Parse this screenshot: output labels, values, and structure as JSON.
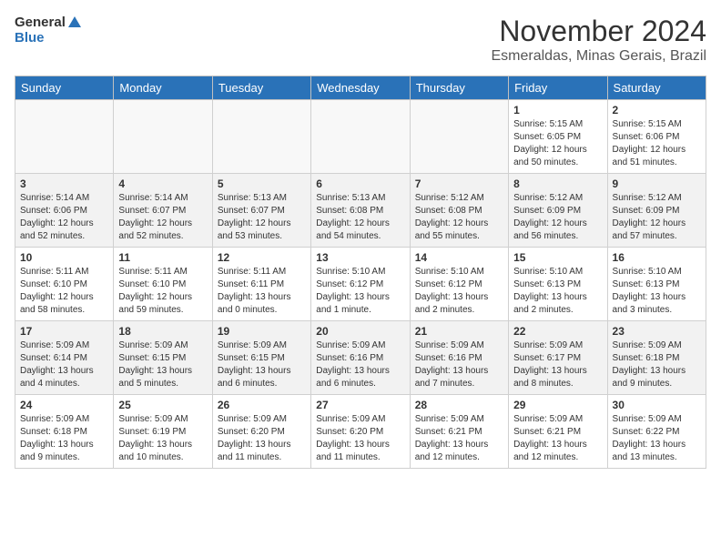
{
  "header": {
    "logo_line1": "General",
    "logo_line2": "Blue",
    "month": "November 2024",
    "location": "Esmeraldas, Minas Gerais, Brazil"
  },
  "days_of_week": [
    "Sunday",
    "Monday",
    "Tuesday",
    "Wednesday",
    "Thursday",
    "Friday",
    "Saturday"
  ],
  "weeks": [
    [
      {
        "day": "",
        "info": ""
      },
      {
        "day": "",
        "info": ""
      },
      {
        "day": "",
        "info": ""
      },
      {
        "day": "",
        "info": ""
      },
      {
        "day": "",
        "info": ""
      },
      {
        "day": "1",
        "info": "Sunrise: 5:15 AM\nSunset: 6:05 PM\nDaylight: 12 hours and 50 minutes."
      },
      {
        "day": "2",
        "info": "Sunrise: 5:15 AM\nSunset: 6:06 PM\nDaylight: 12 hours and 51 minutes."
      }
    ],
    [
      {
        "day": "3",
        "info": "Sunrise: 5:14 AM\nSunset: 6:06 PM\nDaylight: 12 hours and 52 minutes."
      },
      {
        "day": "4",
        "info": "Sunrise: 5:14 AM\nSunset: 6:07 PM\nDaylight: 12 hours and 52 minutes."
      },
      {
        "day": "5",
        "info": "Sunrise: 5:13 AM\nSunset: 6:07 PM\nDaylight: 12 hours and 53 minutes."
      },
      {
        "day": "6",
        "info": "Sunrise: 5:13 AM\nSunset: 6:08 PM\nDaylight: 12 hours and 54 minutes."
      },
      {
        "day": "7",
        "info": "Sunrise: 5:12 AM\nSunset: 6:08 PM\nDaylight: 12 hours and 55 minutes."
      },
      {
        "day": "8",
        "info": "Sunrise: 5:12 AM\nSunset: 6:09 PM\nDaylight: 12 hours and 56 minutes."
      },
      {
        "day": "9",
        "info": "Sunrise: 5:12 AM\nSunset: 6:09 PM\nDaylight: 12 hours and 57 minutes."
      }
    ],
    [
      {
        "day": "10",
        "info": "Sunrise: 5:11 AM\nSunset: 6:10 PM\nDaylight: 12 hours and 58 minutes."
      },
      {
        "day": "11",
        "info": "Sunrise: 5:11 AM\nSunset: 6:10 PM\nDaylight: 12 hours and 59 minutes."
      },
      {
        "day": "12",
        "info": "Sunrise: 5:11 AM\nSunset: 6:11 PM\nDaylight: 13 hours and 0 minutes."
      },
      {
        "day": "13",
        "info": "Sunrise: 5:10 AM\nSunset: 6:12 PM\nDaylight: 13 hours and 1 minute."
      },
      {
        "day": "14",
        "info": "Sunrise: 5:10 AM\nSunset: 6:12 PM\nDaylight: 13 hours and 2 minutes."
      },
      {
        "day": "15",
        "info": "Sunrise: 5:10 AM\nSunset: 6:13 PM\nDaylight: 13 hours and 2 minutes."
      },
      {
        "day": "16",
        "info": "Sunrise: 5:10 AM\nSunset: 6:13 PM\nDaylight: 13 hours and 3 minutes."
      }
    ],
    [
      {
        "day": "17",
        "info": "Sunrise: 5:09 AM\nSunset: 6:14 PM\nDaylight: 13 hours and 4 minutes."
      },
      {
        "day": "18",
        "info": "Sunrise: 5:09 AM\nSunset: 6:15 PM\nDaylight: 13 hours and 5 minutes."
      },
      {
        "day": "19",
        "info": "Sunrise: 5:09 AM\nSunset: 6:15 PM\nDaylight: 13 hours and 6 minutes."
      },
      {
        "day": "20",
        "info": "Sunrise: 5:09 AM\nSunset: 6:16 PM\nDaylight: 13 hours and 6 minutes."
      },
      {
        "day": "21",
        "info": "Sunrise: 5:09 AM\nSunset: 6:16 PM\nDaylight: 13 hours and 7 minutes."
      },
      {
        "day": "22",
        "info": "Sunrise: 5:09 AM\nSunset: 6:17 PM\nDaylight: 13 hours and 8 minutes."
      },
      {
        "day": "23",
        "info": "Sunrise: 5:09 AM\nSunset: 6:18 PM\nDaylight: 13 hours and 9 minutes."
      }
    ],
    [
      {
        "day": "24",
        "info": "Sunrise: 5:09 AM\nSunset: 6:18 PM\nDaylight: 13 hours and 9 minutes."
      },
      {
        "day": "25",
        "info": "Sunrise: 5:09 AM\nSunset: 6:19 PM\nDaylight: 13 hours and 10 minutes."
      },
      {
        "day": "26",
        "info": "Sunrise: 5:09 AM\nSunset: 6:20 PM\nDaylight: 13 hours and 11 minutes."
      },
      {
        "day": "27",
        "info": "Sunrise: 5:09 AM\nSunset: 6:20 PM\nDaylight: 13 hours and 11 minutes."
      },
      {
        "day": "28",
        "info": "Sunrise: 5:09 AM\nSunset: 6:21 PM\nDaylight: 13 hours and 12 minutes."
      },
      {
        "day": "29",
        "info": "Sunrise: 5:09 AM\nSunset: 6:21 PM\nDaylight: 13 hours and 12 minutes."
      },
      {
        "day": "30",
        "info": "Sunrise: 5:09 AM\nSunset: 6:22 PM\nDaylight: 13 hours and 13 minutes."
      }
    ]
  ]
}
